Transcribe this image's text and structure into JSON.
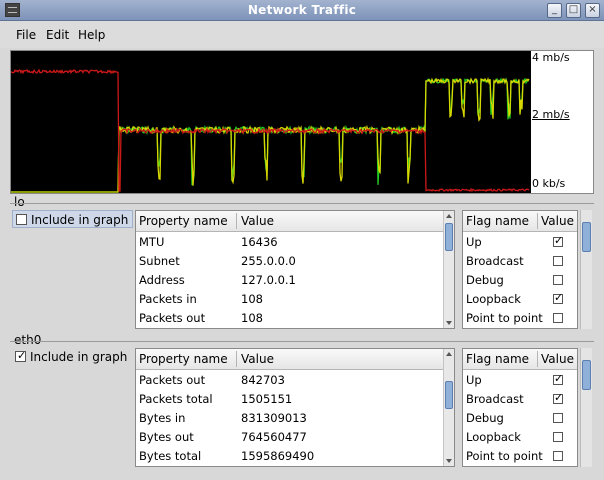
{
  "window": {
    "title": "Network Traffic",
    "icon": "terminal-icon",
    "buttons": {
      "minimize": "_",
      "maximize": "□",
      "close": "×"
    }
  },
  "menu": [
    "File",
    "Edit",
    "Help"
  ],
  "graph": {
    "y_labels": {
      "top": "4 mb/s",
      "mid": "2 mb/s",
      "bottom": "0 kb/s"
    },
    "colors": {
      "background": "#000000",
      "red": "#cc1818",
      "green": "#22cc22",
      "yellow": "#d8d800"
    }
  },
  "interfaces": [
    {
      "name": "lo",
      "include_label": "Include in graph",
      "include_checked": false,
      "property_header": "Property name",
      "value_header": "Value",
      "properties": [
        {
          "name": "MTU",
          "value": "16436"
        },
        {
          "name": "Subnet",
          "value": "255.0.0.0"
        },
        {
          "name": "Address",
          "value": "127.0.0.1"
        },
        {
          "name": "Packets in",
          "value": "108"
        },
        {
          "name": "Packets out",
          "value": "108"
        }
      ],
      "flag_header": "Flag name",
      "flag_value_header": "Value",
      "flags": [
        {
          "name": "Up",
          "checked": true
        },
        {
          "name": "Broadcast",
          "checked": false
        },
        {
          "name": "Debug",
          "checked": false
        },
        {
          "name": "Loopback",
          "checked": true
        },
        {
          "name": "Point to point",
          "checked": false
        }
      ]
    },
    {
      "name": "eth0",
      "include_label": "Include in graph",
      "include_checked": true,
      "property_header": "Property name",
      "value_header": "Value",
      "properties": [
        {
          "name": "Packets out",
          "value": "842703"
        },
        {
          "name": "Packets total",
          "value": "1505151"
        },
        {
          "name": "Bytes in",
          "value": "831309013"
        },
        {
          "name": "Bytes out",
          "value": "764560477"
        },
        {
          "name": "Bytes total",
          "value": "1595869490"
        }
      ],
      "flag_header": "Flag name",
      "flag_value_header": "Value",
      "flags": [
        {
          "name": "Up",
          "checked": true
        },
        {
          "name": "Broadcast",
          "checked": true
        },
        {
          "name": "Debug",
          "checked": false
        },
        {
          "name": "Loopback",
          "checked": false
        },
        {
          "name": "Point to point",
          "checked": false
        }
      ]
    }
  ]
}
